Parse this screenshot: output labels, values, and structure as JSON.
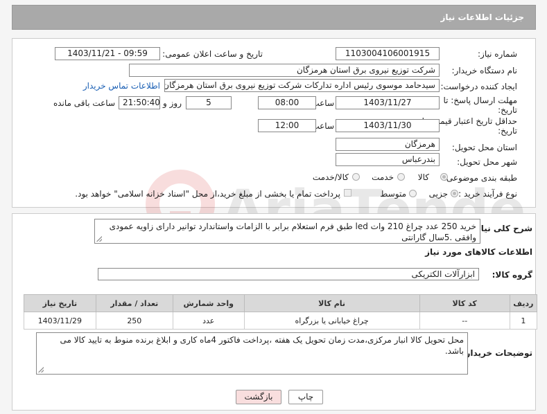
{
  "header": {
    "title": "جزئیات اطلاعات نیاز"
  },
  "form": {
    "need_number": {
      "label": "شماره نیاز:",
      "value": "1103004106001915"
    },
    "announce_datetime": {
      "label": "تاریخ و ساعت اعلان عمومی:",
      "value": "1403/11/21 - 09:59"
    },
    "buyer_org": {
      "label": "نام دستگاه خریدار:",
      "value": "شرکت توزیع نیروی برق استان هرمزگان"
    },
    "requester": {
      "label": "ایجاد کننده درخواست:",
      "value": "سیدحامد موسوی رئیس اداره تدارکات شرکت توزیع نیروی برق استان هرمزگان",
      "contact_link": "اطلاعات تماس خریدار"
    },
    "reply_deadline": {
      "label_line1": "مهلت ارسال پاسخ: تا",
      "label_line2": "تاریخ:",
      "date": "1403/11/27",
      "time_label": "ساعت",
      "time": "08:00",
      "days": "5",
      "days_label": "روز و",
      "remaining": "21:50:40",
      "remaining_label": "ساعت باقی مانده"
    },
    "price_validity": {
      "label_line1": "حداقل تاریخ اعتبار قیمت: تا",
      "label_line2": "تاریخ:",
      "date": "1403/11/30",
      "time_label": "ساعت",
      "time": "12:00"
    },
    "province": {
      "label": "استان محل تحویل:",
      "value": "هرمزگان"
    },
    "city": {
      "label": "شهر محل تحویل:",
      "value": "بندرعباس"
    },
    "category": {
      "label": "طبقه بندی موضوعی:",
      "options": [
        "کالا",
        "خدمت",
        "کالا/خدمت"
      ],
      "selected": "کالا"
    },
    "purchase_type": {
      "label": "نوع فرآیند خرید :",
      "options": [
        "جزیی",
        "متوسط"
      ],
      "selected": "جزیی",
      "payment_note": "پرداخت تمام یا بخشی از مبلغ خرید،از محل \"اسناد خزانه اسلامی\" خواهد بود."
    }
  },
  "details": {
    "summary_label": "شرح کلی نیاز:",
    "summary_value": "خرید 250 عدد چراغ 210 وات led طبق فرم استعلام برابر با الزامات واستاندارد توانیر دارای زاویه عمودی وافقی .5سال گارانتی",
    "goods_info_title": "اطلاعات کالاهای مورد نیاز",
    "goods_group_label": "گروه کالا:",
    "goods_group_value": "ابزارآلات الکتریکی",
    "table": {
      "headers": [
        "ردیف",
        "کد کالا",
        "نام کالا",
        "واحد شمارش",
        "تعداد / مقدار",
        "تاریخ نیاز"
      ],
      "rows": [
        [
          "1",
          "--",
          "چراغ خیابانی یا بزرگراه",
          "عدد",
          "250",
          "1403/11/29"
        ]
      ]
    },
    "buyer_notes_label": "توضیحات خریدار:",
    "buyer_notes_value": "محل تحویل کالا انبار مرکزی،مدت زمان تحویل یک هفته ،پرداخت فاکتور 4ماه کاری و ابلاغ برنده منوط به تایید کالا می باشد."
  },
  "buttons": {
    "print": "چاپ",
    "back": "بازگشت"
  },
  "watermark": {
    "text": "AriaTender.neT"
  }
}
